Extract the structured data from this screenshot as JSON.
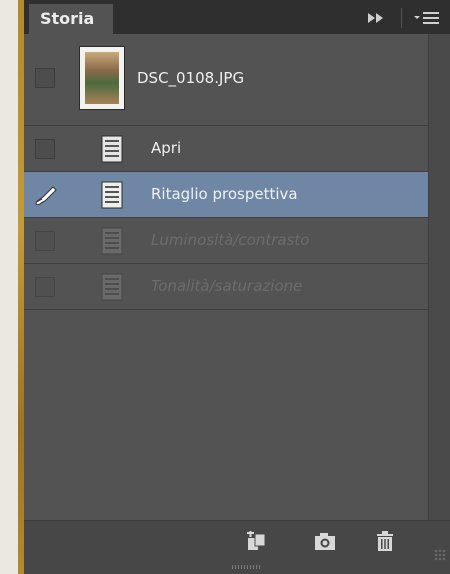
{
  "panel": {
    "tab_label": "Storia"
  },
  "snapshot": {
    "name": "DSC_0108.JPG"
  },
  "history_steps": [
    {
      "label": "Apri",
      "state": "active"
    },
    {
      "label": "Ritaglio prospettiva",
      "state": "selected"
    },
    {
      "label": "Luminosità/contrasto",
      "state": "undone"
    },
    {
      "label": "Tonalità/saturazione",
      "state": "undone"
    }
  ],
  "icons": {
    "collapse": "double-chevron-right-icon",
    "menu": "panel-menu-icon",
    "history_brush": "history-brush-icon",
    "step": "document-icon",
    "new_document": "new-document-from-state-icon",
    "snapshot": "camera-icon",
    "delete": "trash-icon"
  },
  "colors": {
    "selected_row": "#6f87a5",
    "panel_bg": "#535353",
    "accent_stripe": "#b08a2e"
  }
}
